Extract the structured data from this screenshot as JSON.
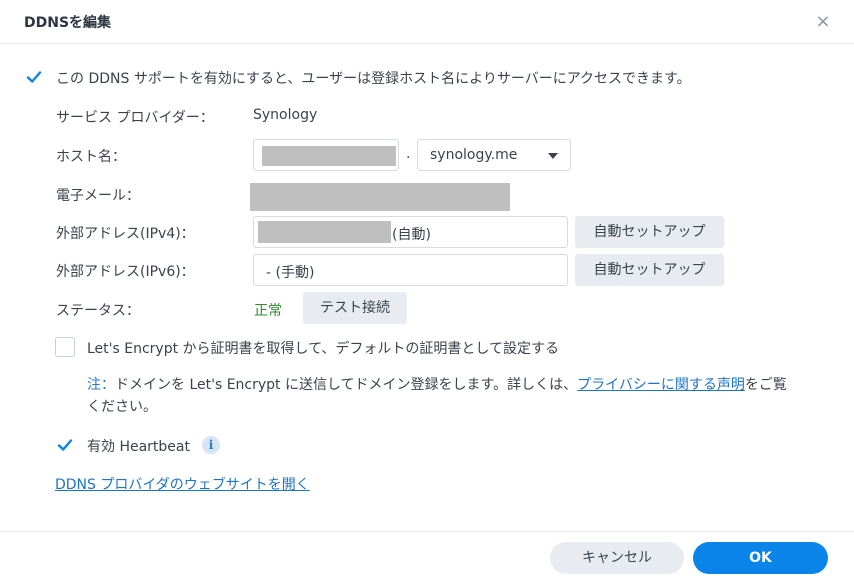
{
  "dialog": {
    "title": "DDNSを編集",
    "close_label": "×"
  },
  "enable_checkbox": {
    "checked": true,
    "label": "この DDNS サポートを有効にすると、ユーザーは登録ホスト名によりサーバーにアクセスできます。"
  },
  "fields": {
    "provider_label": "サービス プロバイダー：",
    "provider_value": "Synology",
    "hostname_label": "ホスト名：",
    "hostname_separator": ".",
    "hostname_domain": "synology.me",
    "email_label": "電子メール：",
    "ipv4_label": "外部アドレス(IPv4)：",
    "ipv4_suffix": "(自動)",
    "ipv4_button": "自動セットアップ",
    "ipv6_label": "外部アドレス(IPv6)：",
    "ipv6_value": "- (手動)",
    "ipv6_button": "自動セットアップ",
    "status_label": "ステータス：",
    "status_value": "正常",
    "test_button": "テスト接続"
  },
  "letsencrypt": {
    "checked": false,
    "label": "Let's Encrypt から証明書を取得して、デフォルトの証明書として設定する"
  },
  "note": {
    "prefix": "注：",
    "text1": "ドメインを Let's Encrypt に送信してドメイン登録をします。詳しくは、",
    "link": "プライバシーに関する声明",
    "text2": "をご覧",
    "text3": "ください。"
  },
  "heartbeat": {
    "checked": true,
    "label": "有効 Heartbeat",
    "info_icon": "i"
  },
  "provider_link": "DDNS プロバイダのウェブサイトを開く",
  "footer": {
    "cancel": "キャンセル",
    "ok": "OK"
  },
  "colors": {
    "accent": "#0a84e8",
    "status_ok": "#2e8b2e",
    "link": "#1f74c4"
  }
}
